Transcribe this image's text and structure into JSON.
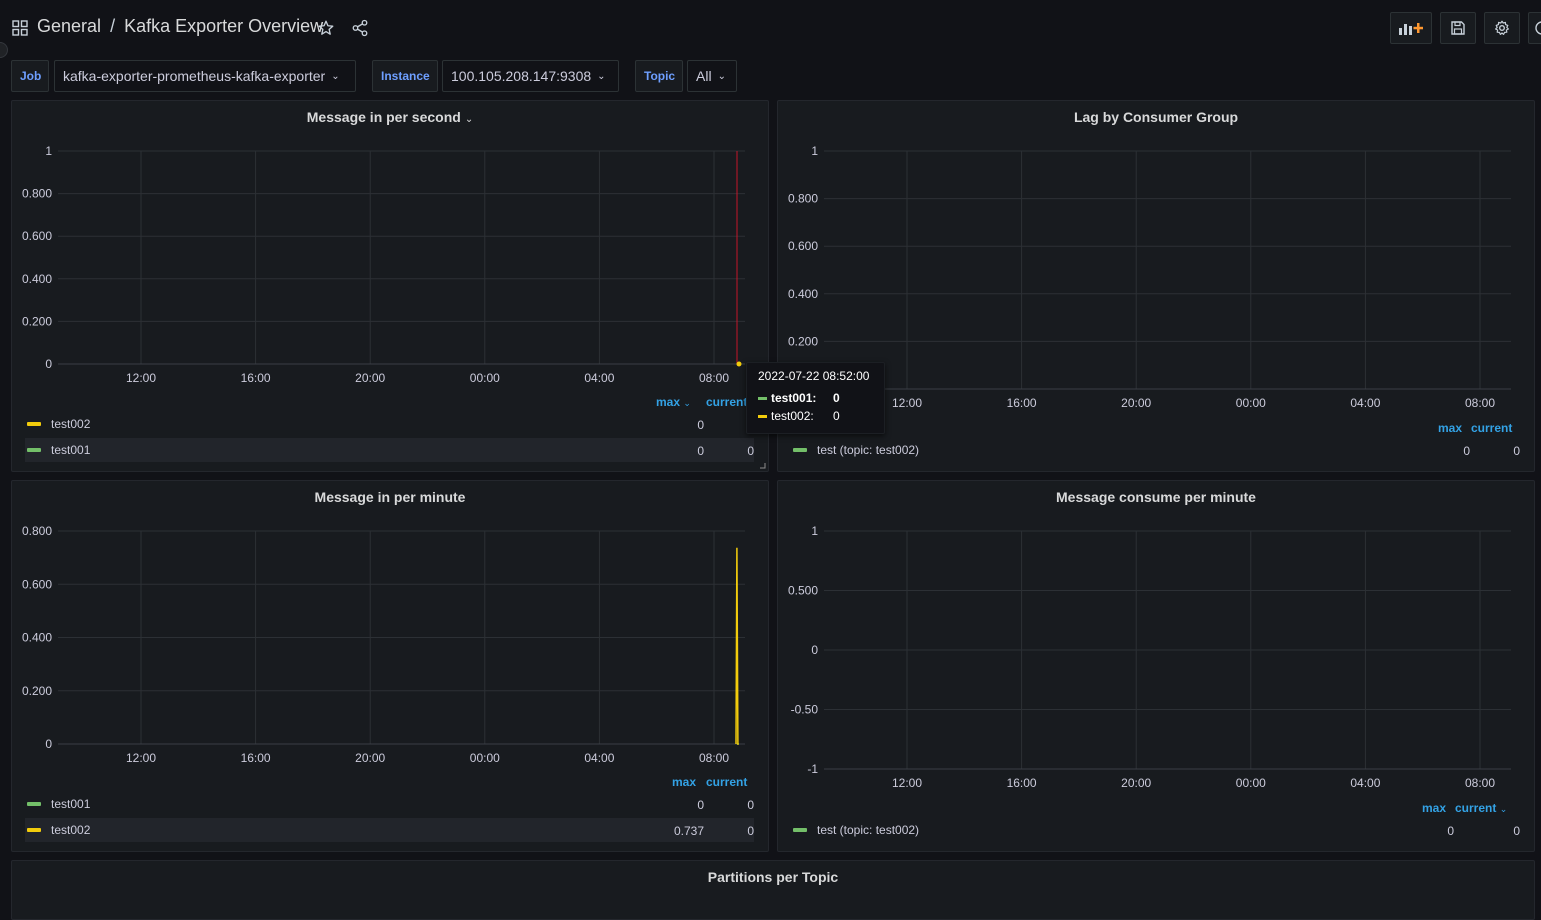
{
  "header": {
    "folder": "General",
    "separator": "/",
    "title": "Kafka Exporter Overview",
    "icons": [
      "apps-icon",
      "star-icon",
      "share-icon",
      "add-panel-icon",
      "save-icon",
      "settings-icon"
    ]
  },
  "variables": [
    {
      "label": "Job",
      "value": "kafka-exporter-prometheus-kafka-exporter"
    },
    {
      "label": "Instance",
      "value": "100.105.208.147:9308"
    },
    {
      "label": "Topic",
      "value": "All"
    }
  ],
  "colors": {
    "green": "#73bf69",
    "yellow": "#f2cc0c",
    "accent": "#33a2e5",
    "label_blue": "#6e9fff",
    "cursor_red": "#c4162a"
  },
  "panels": [
    {
      "title": "Message in per second",
      "legend_headers": {
        "max": "max",
        "current": "current"
      },
      "legend": [
        {
          "name": "test002",
          "color": "#f2cc0c",
          "max": "0",
          "current": ""
        },
        {
          "name": "test001",
          "color": "#73bf69",
          "max": "0",
          "current": "0"
        }
      ]
    },
    {
      "title": "Lag by Consumer Group",
      "legend_headers": {
        "max": "max",
        "current": "current"
      },
      "legend": [
        {
          "name": "test (topic: test002)",
          "color": "#73bf69",
          "max": "0",
          "current": "0"
        }
      ]
    },
    {
      "title": "Message in per minute",
      "legend_headers": {
        "max": "max",
        "current": "current"
      },
      "legend": [
        {
          "name": "test001",
          "color": "#73bf69",
          "max": "0",
          "current": "0"
        },
        {
          "name": "test002",
          "color": "#f2cc0c",
          "max": "0.737",
          "current": "0"
        }
      ]
    },
    {
      "title": "Message consume per minute",
      "legend_headers": {
        "max": "max",
        "current": "current"
      },
      "legend": [
        {
          "name": "test (topic: test002)",
          "color": "#73bf69",
          "max": "0",
          "current": "0"
        }
      ]
    },
    {
      "title": "Partitions per Topic"
    }
  ],
  "tooltip": {
    "time": "2022-07-22 08:52:00",
    "rows": [
      {
        "name": "test001:",
        "value": "0",
        "color": "#73bf69"
      },
      {
        "name": "test002:",
        "value": "0",
        "color": "#f2cc0c"
      }
    ]
  },
  "chart_data": [
    {
      "type": "line",
      "title": "Message in per second",
      "x_ticks": [
        "12:00",
        "16:00",
        "20:00",
        "00:00",
        "04:00",
        "08:00"
      ],
      "y_ticks": [
        "0",
        "0.200",
        "0.400",
        "0.600",
        "0.800",
        "1"
      ],
      "ylim": [
        0,
        1
      ],
      "grid": true,
      "legend_placement": "bottom",
      "series": [
        {
          "name": "test002",
          "x": [
            "08:50",
            "08:52"
          ],
          "values": [
            0,
            0
          ]
        },
        {
          "name": "test001",
          "x": [
            "08:50",
            "08:52"
          ],
          "values": [
            0,
            0
          ]
        }
      ]
    },
    {
      "type": "line",
      "title": "Lag by Consumer Group",
      "x_ticks": [
        "12:00",
        "16:00",
        "20:00",
        "00:00",
        "04:00",
        "08:00"
      ],
      "y_ticks": [
        "0.200",
        "0.400",
        "0.600",
        "0.800",
        "1"
      ],
      "ylim": [
        0,
        1
      ],
      "grid": true,
      "legend_placement": "bottom",
      "series": [
        {
          "name": "test (topic: test002)",
          "x": [],
          "values": []
        }
      ]
    },
    {
      "type": "line",
      "title": "Message in per minute",
      "x_ticks": [
        "12:00",
        "16:00",
        "20:00",
        "00:00",
        "04:00",
        "08:00"
      ],
      "y_ticks": [
        "0",
        "0.200",
        "0.400",
        "0.600",
        "0.800"
      ],
      "ylim": [
        0,
        0.8
      ],
      "grid": true,
      "legend_placement": "bottom",
      "series": [
        {
          "name": "test001",
          "x": [
            "08:48",
            "08:52"
          ],
          "values": [
            0,
            0
          ]
        },
        {
          "name": "test002",
          "x": [
            "08:46",
            "08:48",
            "08:50",
            "08:52"
          ],
          "values": [
            0,
            0.737,
            0,
            0
          ]
        }
      ]
    },
    {
      "type": "line",
      "title": "Message consume per minute",
      "x_ticks": [
        "12:00",
        "16:00",
        "20:00",
        "00:00",
        "04:00",
        "08:00"
      ],
      "y_ticks": [
        "-1",
        "-0.50",
        "0",
        "0.500",
        "1"
      ],
      "ylim": [
        -1,
        1
      ],
      "grid": true,
      "legend_placement": "bottom",
      "series": [
        {
          "name": "test (topic: test002)",
          "x": [],
          "values": []
        }
      ]
    }
  ]
}
